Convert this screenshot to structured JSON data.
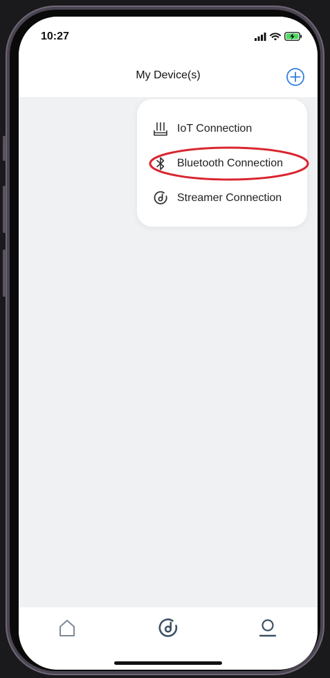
{
  "status_bar": {
    "time": "10:27",
    "icons": [
      "signal-icon",
      "wifi-icon",
      "battery-charging-icon"
    ]
  },
  "nav": {
    "title": "My Device(s)",
    "add_icon": "plus-circle-icon"
  },
  "menu": {
    "items": [
      {
        "label": "IoT Connection",
        "icon": "router-icon"
      },
      {
        "label": "Bluetooth Connection",
        "icon": "bluetooth-icon"
      },
      {
        "label": "Streamer Connection",
        "icon": "streamer-icon"
      }
    ],
    "highlighted_index": 1
  },
  "tabs": {
    "items": [
      {
        "icon": "home-icon"
      },
      {
        "icon": "streamer-icon"
      },
      {
        "icon": "user-icon"
      }
    ]
  },
  "colors": {
    "accent": "#2f7fe0",
    "highlight": "#d9252f",
    "tab_icon": "#3e5066",
    "background": "#f0f1f3"
  }
}
